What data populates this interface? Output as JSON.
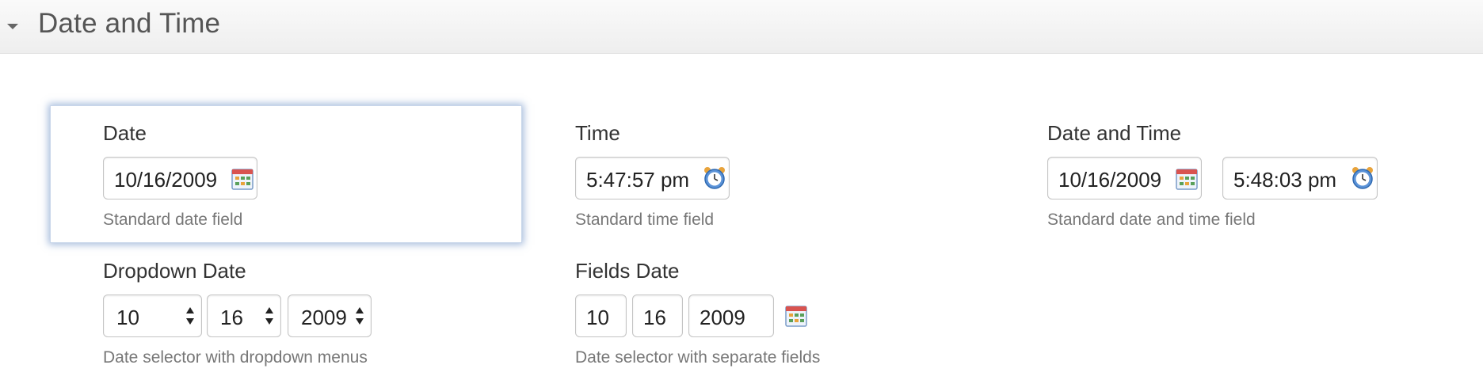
{
  "section": {
    "title": "Date and Time"
  },
  "date_field": {
    "label": "Date",
    "value": "10/16/2009",
    "hint": "Standard date field"
  },
  "time_field": {
    "label": "Time",
    "value": "5:47:57 pm",
    "hint": "Standard time field"
  },
  "datetime_field": {
    "label": "Date and Time",
    "date_value": "10/16/2009",
    "time_value": "5:48:03 pm",
    "hint": "Standard date and time field"
  },
  "dropdown_date": {
    "label": "Dropdown Date",
    "month": "10",
    "day": "16",
    "year": "2009",
    "hint": "Date selector with dropdown menus"
  },
  "fields_date": {
    "label": "Fields Date",
    "month": "10",
    "day": "16",
    "year": "2009",
    "hint": "Date selector with separate fields"
  },
  "icons": {
    "calendar": "calendar-icon",
    "clock": "alarm-clock-icon",
    "select": "up-down-arrows-icon",
    "collapse": "caret-down-icon"
  }
}
